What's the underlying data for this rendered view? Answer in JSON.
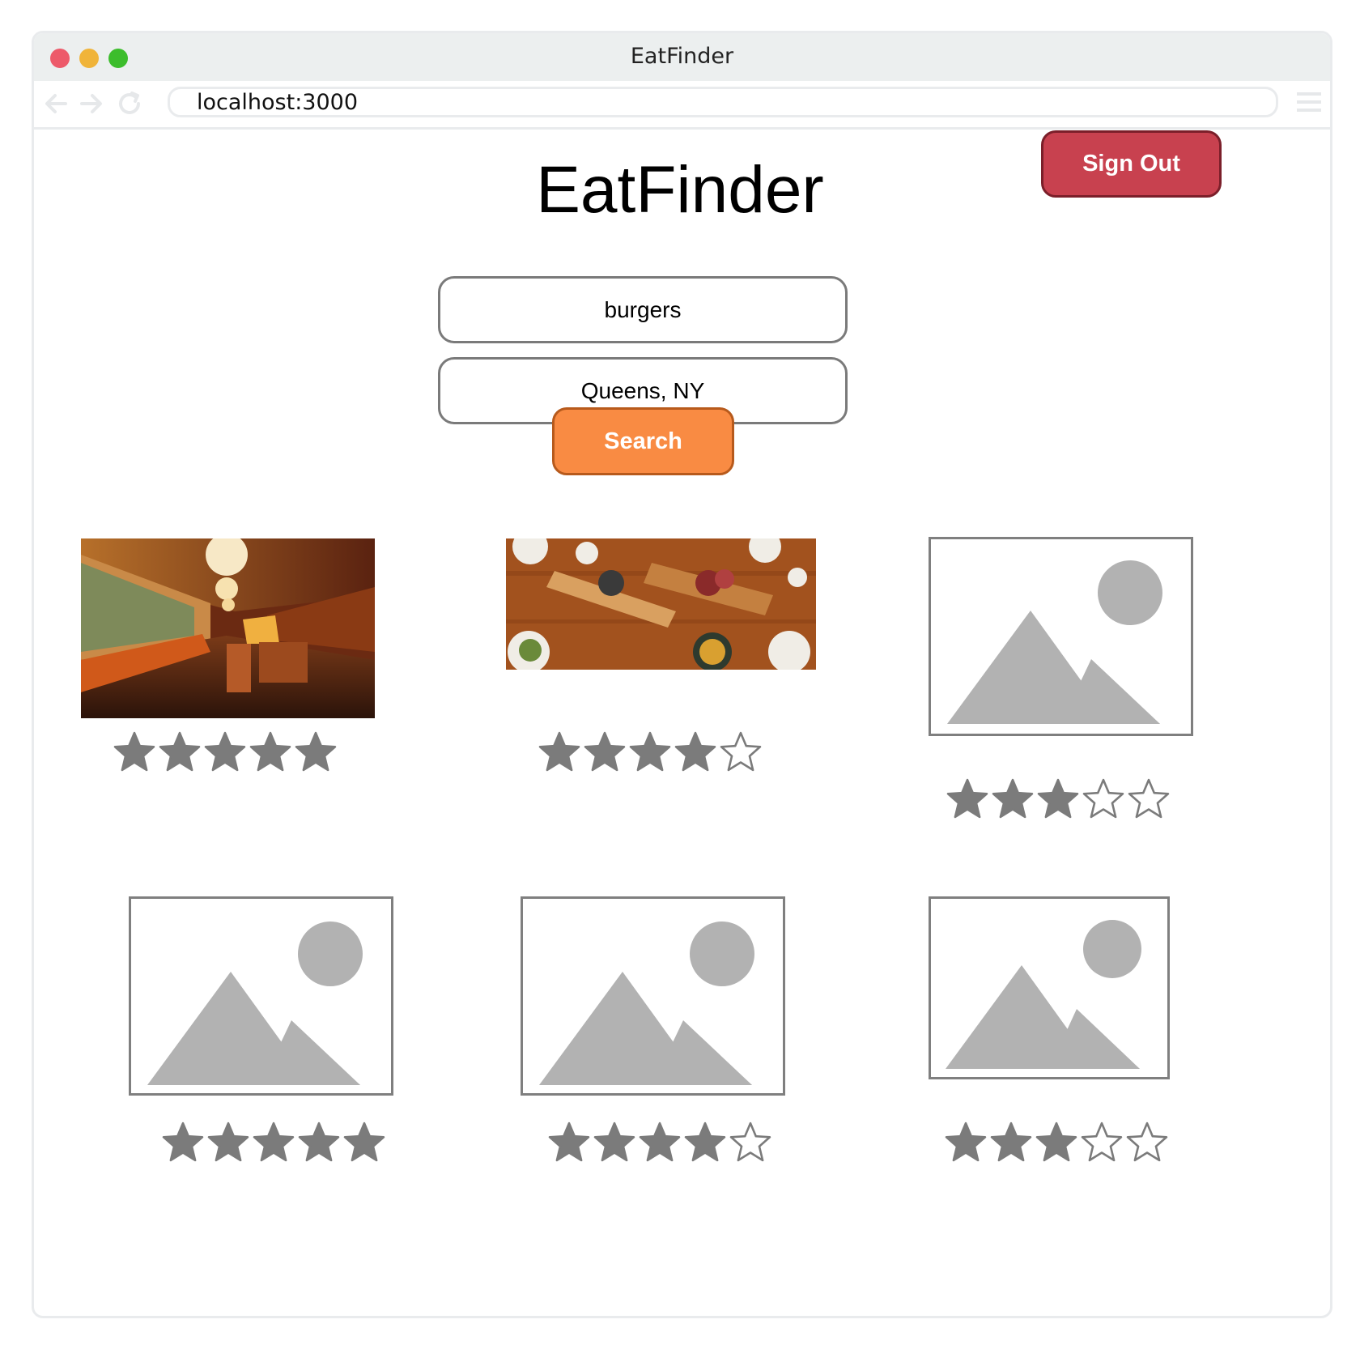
{
  "window": {
    "title": "EatFinder",
    "url": "localhost:3000",
    "icons": [
      "back-arrow-icon",
      "forward-arrow-icon",
      "reload-icon",
      "menu-icon"
    ]
  },
  "header": {
    "sign_out_label": "Sign Out",
    "title": "EatFinder"
  },
  "search": {
    "term_value": "burgers",
    "location_value": "Queens, NY",
    "button_label": "Search"
  },
  "colors": {
    "sign_out_bg": "#c8414f",
    "search_bg": "#f98b43",
    "star_fill": "#7b7b7b",
    "placeholder_gray": "#b2b2b2"
  },
  "results": [
    {
      "image": "restaurant-interior-photo",
      "rating": 5
    },
    {
      "image": "food-table-photo",
      "rating": 4
    },
    {
      "image": "image-placeholder-icon",
      "rating": 3
    },
    {
      "image": "image-placeholder-icon",
      "rating": 5
    },
    {
      "image": "image-placeholder-icon",
      "rating": 4
    },
    {
      "image": "image-placeholder-icon",
      "rating": 3
    }
  ]
}
